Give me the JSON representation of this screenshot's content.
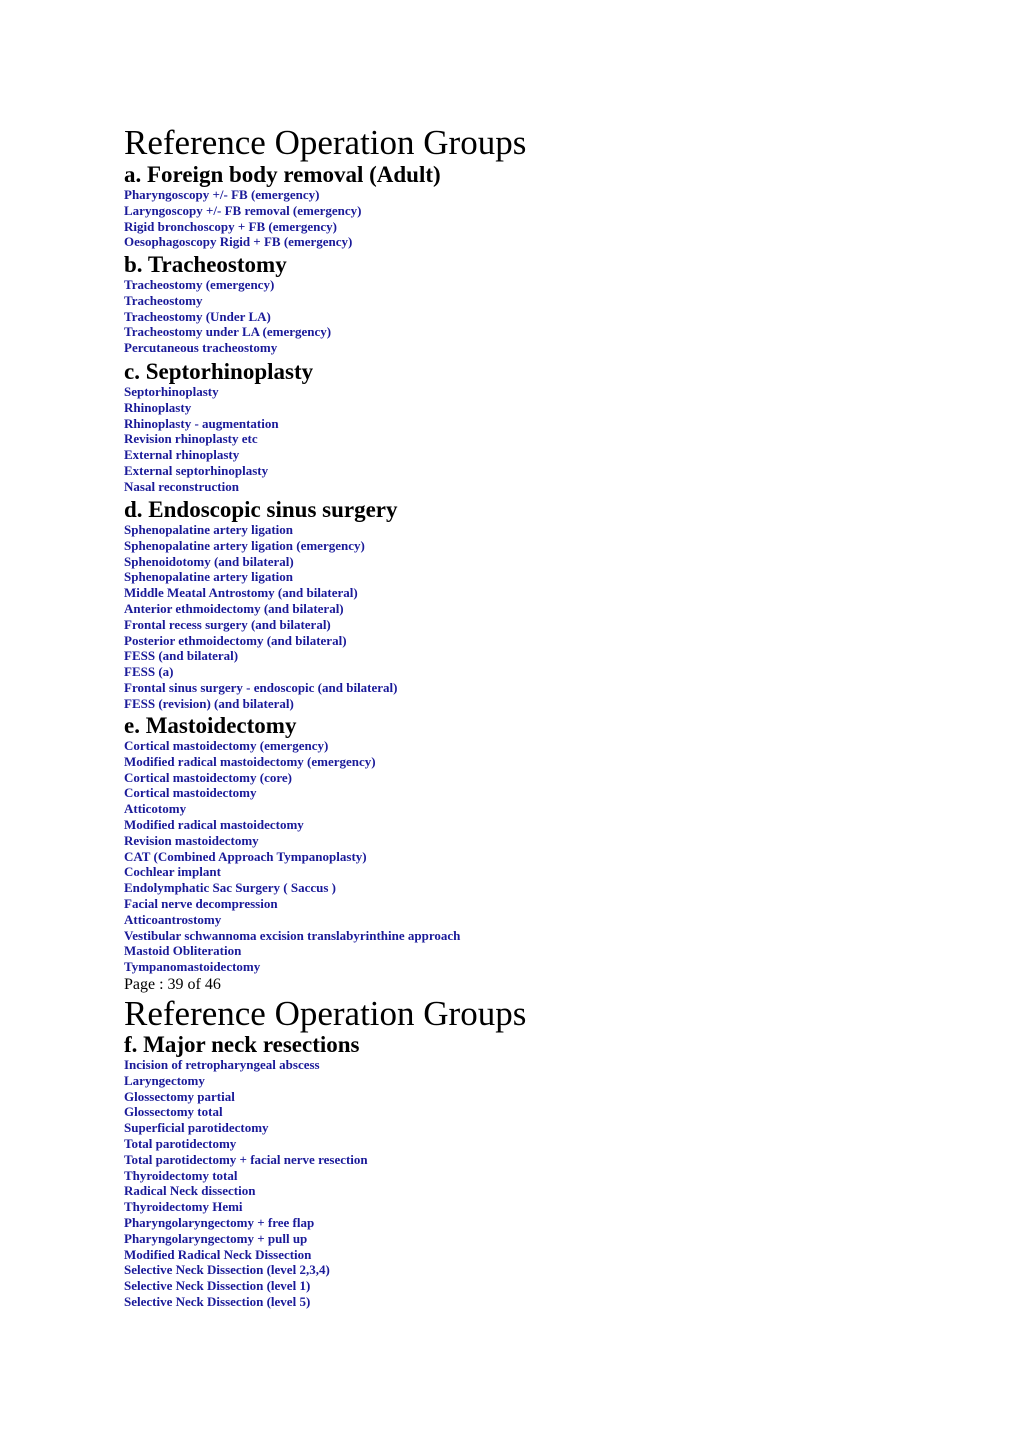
{
  "pages": [
    {
      "title": "Reference Operation Groups",
      "sections": [
        {
          "heading": "a. Foreign body removal (Adult)",
          "items": [
            "Pharyngoscopy +/- FB (emergency)",
            "Laryngoscopy +/- FB removal (emergency)",
            "Rigid bronchoscopy + FB (emergency)",
            "Oesophagoscopy Rigid + FB (emergency)"
          ]
        },
        {
          "heading": "b. Tracheostomy",
          "items": [
            "Tracheostomy (emergency)",
            "Tracheostomy",
            "Tracheostomy (Under LA)",
            "Tracheostomy under LA (emergency)",
            "Percutaneous tracheostomy"
          ]
        },
        {
          "heading": "c. Septorhinoplasty",
          "items": [
            "Septorhinoplasty",
            "Rhinoplasty",
            "Rhinoplasty - augmentation",
            "Revision rhinoplasty etc",
            "External rhinoplasty",
            "External septorhinoplasty",
            "Nasal reconstruction"
          ]
        },
        {
          "heading": "d. Endoscopic sinus surgery",
          "items": [
            "Sphenopalatine artery ligation",
            "Sphenopalatine artery ligation (emergency)",
            "Sphenoidotomy (and bilateral)",
            "Sphenopalatine artery ligation",
            "Middle Meatal Antrostomy (and bilateral)",
            "Anterior ethmoidectomy (and bilateral)",
            "Frontal recess surgery (and bilateral)",
            "Posterior ethmoidectomy (and bilateral)",
            "FESS (and bilateral)",
            "FESS (a)",
            "Frontal sinus surgery - endoscopic (and bilateral)",
            "FESS (revision) (and bilateral)"
          ]
        },
        {
          "heading": "e. Mastoidectomy",
          "items": [
            "Cortical mastoidectomy (emergency)",
            "Modified radical mastoidectomy (emergency)",
            "Cortical mastoidectomy (core)",
            "Cortical mastoidectomy",
            "Atticotomy",
            "Modified radical mastoidectomy",
            "Revision mastoidectomy",
            "CAT (Combined Approach Tympanoplasty)",
            "Cochlear implant",
            "Endolymphatic Sac Surgery ( Saccus )",
            "Facial nerve decompression",
            "Atticoantrostomy",
            "Vestibular schwannoma excision translabyrinthine approach",
            "Mastoid Obliteration",
            "Tympanomastoidectomy"
          ]
        }
      ],
      "footer": "Page : 39 of 46"
    },
    {
      "title": "Reference Operation Groups",
      "sections": [
        {
          "heading": "f. Major neck resections",
          "items": [
            "Incision of retropharyngeal abscess",
            "Laryngectomy",
            "Glossectomy partial",
            "Glossectomy total",
            "Superficial parotidectomy",
            "Total parotidectomy",
            "Total parotidectomy + facial nerve resection",
            "Thyroidectomy total",
            "Radical Neck dissection",
            "Thyroidectomy Hemi",
            "Pharyngolaryngectomy + free flap",
            "Pharyngolaryngectomy + pull up",
            "Modified Radical Neck Dissection",
            "Selective Neck Dissection (level 2,3,4)",
            "Selective Neck Dissection (level 1)",
            "Selective Neck Dissection (level 5)"
          ]
        }
      ]
    }
  ],
  "colors": {
    "item_text": "#1a1a99",
    "heading_text": "#000000",
    "background": "#ffffff"
  }
}
